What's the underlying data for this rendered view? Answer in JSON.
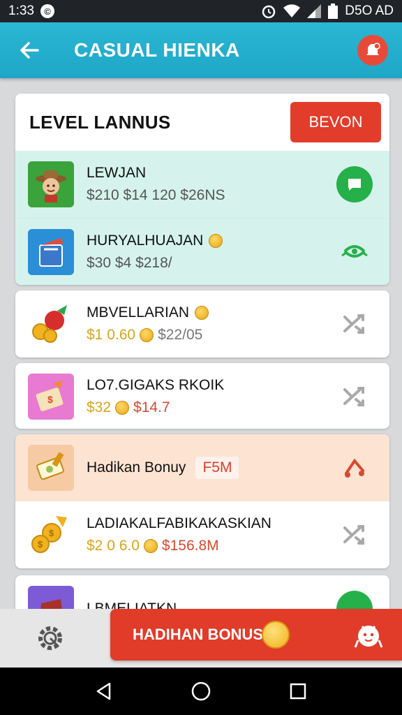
{
  "status_bar": {
    "time": "1:33",
    "right_text": "D5O AD",
    "icons": [
      "notification-icon",
      "alarm-icon",
      "wifi-icon",
      "signal-icon",
      "battery-icon"
    ]
  },
  "app_bar": {
    "title": "CASUAL HIENKA",
    "back_icon": "back-arrow-icon",
    "action_icon": "notification-bell-icon"
  },
  "level_card": {
    "title": "LEVEL LANNUS",
    "button_label": "BEVON",
    "rows": [
      {
        "title": "LEWJAN",
        "sub": "$210 $14 120 $26NS",
        "icon": "cowboy-avatar-icon",
        "action_icon": "chat-icon"
      },
      {
        "title": "HURYALHUAJAN",
        "sub": "$30 $4 $218/",
        "icon": "shopping-bag-icon",
        "action_icon": "share-icon"
      }
    ]
  },
  "items": [
    {
      "title": "MBVELLARIAN",
      "sub_price": "$1 0.60",
      "sub_extra": "$22/05",
      "icon": "apple-coins-icon",
      "action_icon": "shuffle-icon"
    },
    {
      "title": "LO7.GIGAKS RKOIK",
      "sub_price": "$32",
      "sub_extra": "$14.7",
      "icon": "gift-box-icon",
      "action_icon": "shuffle-icon"
    },
    {
      "title": "Hadikan Bonuy",
      "tag": "F5M",
      "icon": "ticket-icon",
      "action_icon": "music-icon"
    },
    {
      "title": "LADIAKALFABIKAKASKIAN",
      "sub_price": "$2 0 6.0",
      "sub_extra": "$156.8M",
      "icon": "coins-icon",
      "action_icon": "shuffle-icon"
    },
    {
      "title": "LBMELIATKN",
      "icon": "gift-bag-icon"
    }
  ],
  "bottom_bar": {
    "button_label": "HADIHAN BONUS",
    "left_icon": "settings-gear-icon",
    "right_icon": "mascot-icon"
  },
  "colors": {
    "accent": "#1ea6c7",
    "primary_red": "#e23c2b",
    "mint": "#d5f3ec",
    "peach": "#fde3d2",
    "green": "#26b04a"
  }
}
